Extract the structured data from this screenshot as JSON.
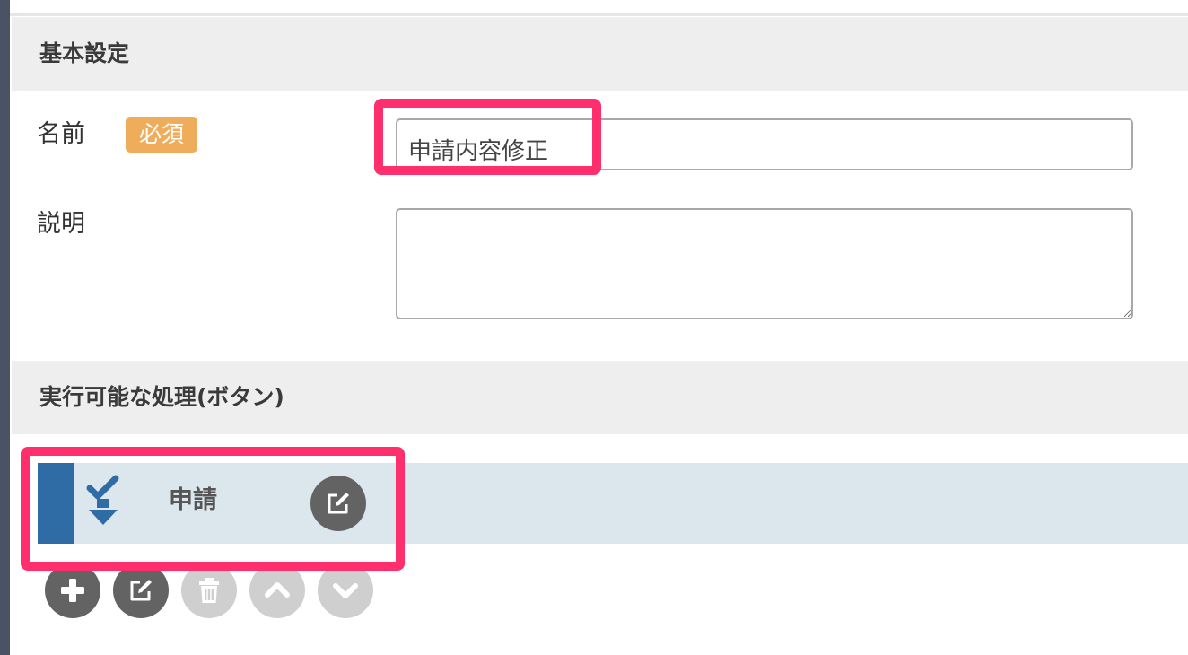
{
  "sections": {
    "basic": {
      "title": "基本設定"
    },
    "actions": {
      "title": "実行可能な処理(ボタン)"
    }
  },
  "fields": {
    "name": {
      "label": "名前",
      "required_badge": "必須",
      "value": "申請内容修正"
    },
    "description": {
      "label": "説明",
      "value": ""
    }
  },
  "action_list": {
    "items": [
      {
        "label": "申請",
        "color": "#2f6ba5",
        "icon": "check-arrow-down-icon",
        "edit_icon": "edit-icon"
      }
    ]
  },
  "toolbar": {
    "buttons": [
      {
        "name": "add",
        "icon": "plus-icon",
        "enabled": true
      },
      {
        "name": "edit",
        "icon": "edit-icon",
        "enabled": true
      },
      {
        "name": "delete",
        "icon": "trash-icon",
        "enabled": false
      },
      {
        "name": "move-up",
        "icon": "chevron-up-icon",
        "enabled": false
      },
      {
        "name": "move-down",
        "icon": "chevron-down-icon",
        "enabled": false
      }
    ]
  },
  "colors": {
    "highlight": "#ff2e6d",
    "badge": "#efad5c",
    "action_accent": "#2f6ba5",
    "sidebar": "#4a5366"
  }
}
